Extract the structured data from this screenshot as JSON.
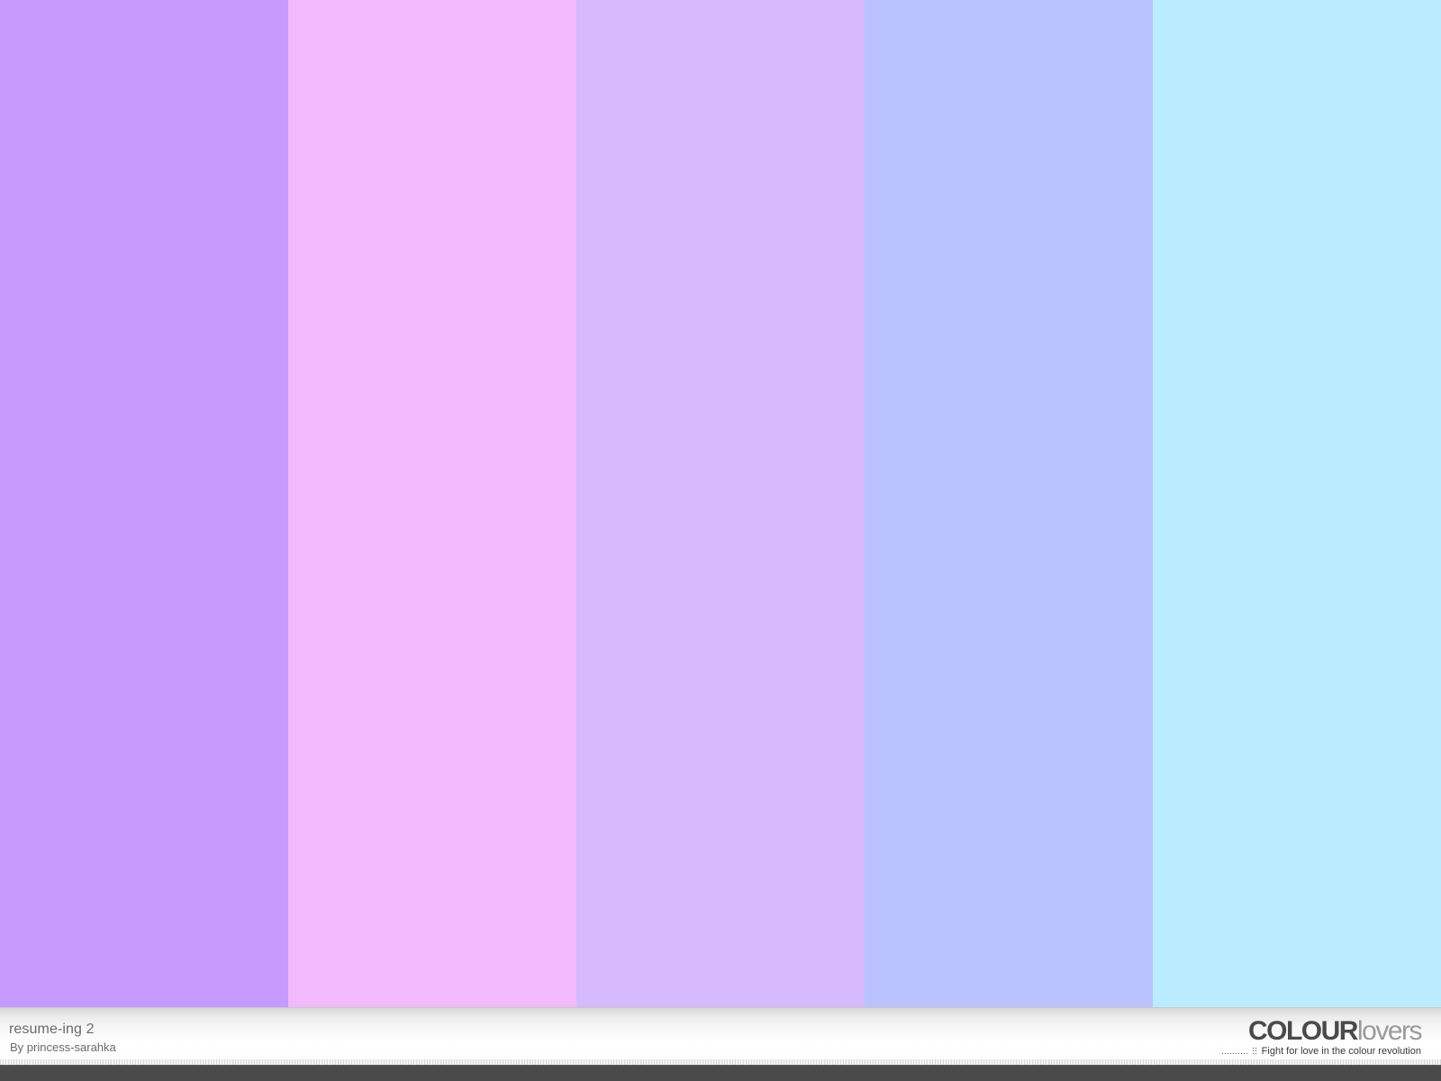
{
  "palette": {
    "title": "resume-ing 2",
    "author": "By princess-sarahka",
    "colors": [
      "#c69aff",
      "#f2b9ff",
      "#d7b9ff",
      "#b9c2ff",
      "#bbebff"
    ]
  },
  "logo": {
    "word_strong": "COLOUR",
    "word_light": "lovers",
    "tagline": "Fight for love in the colour revolution"
  }
}
